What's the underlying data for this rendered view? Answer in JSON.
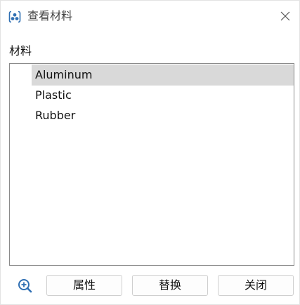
{
  "window": {
    "title": "查看材料",
    "icon": "material-icon",
    "close_icon": "close-icon"
  },
  "section": {
    "label": "材料"
  },
  "materials": [
    {
      "name": "Aluminum",
      "selected": true
    },
    {
      "name": "Plastic",
      "selected": false
    },
    {
      "name": "Rubber",
      "selected": false
    }
  ],
  "toolbar": {
    "zoom_icon": "zoom-in-icon",
    "properties_label": "属性",
    "replace_label": "替换",
    "close_label": "关闭"
  },
  "colors": {
    "accent": "#2f6fb3",
    "selection": "#d9d9d9",
    "border": "#8a8a8a"
  }
}
